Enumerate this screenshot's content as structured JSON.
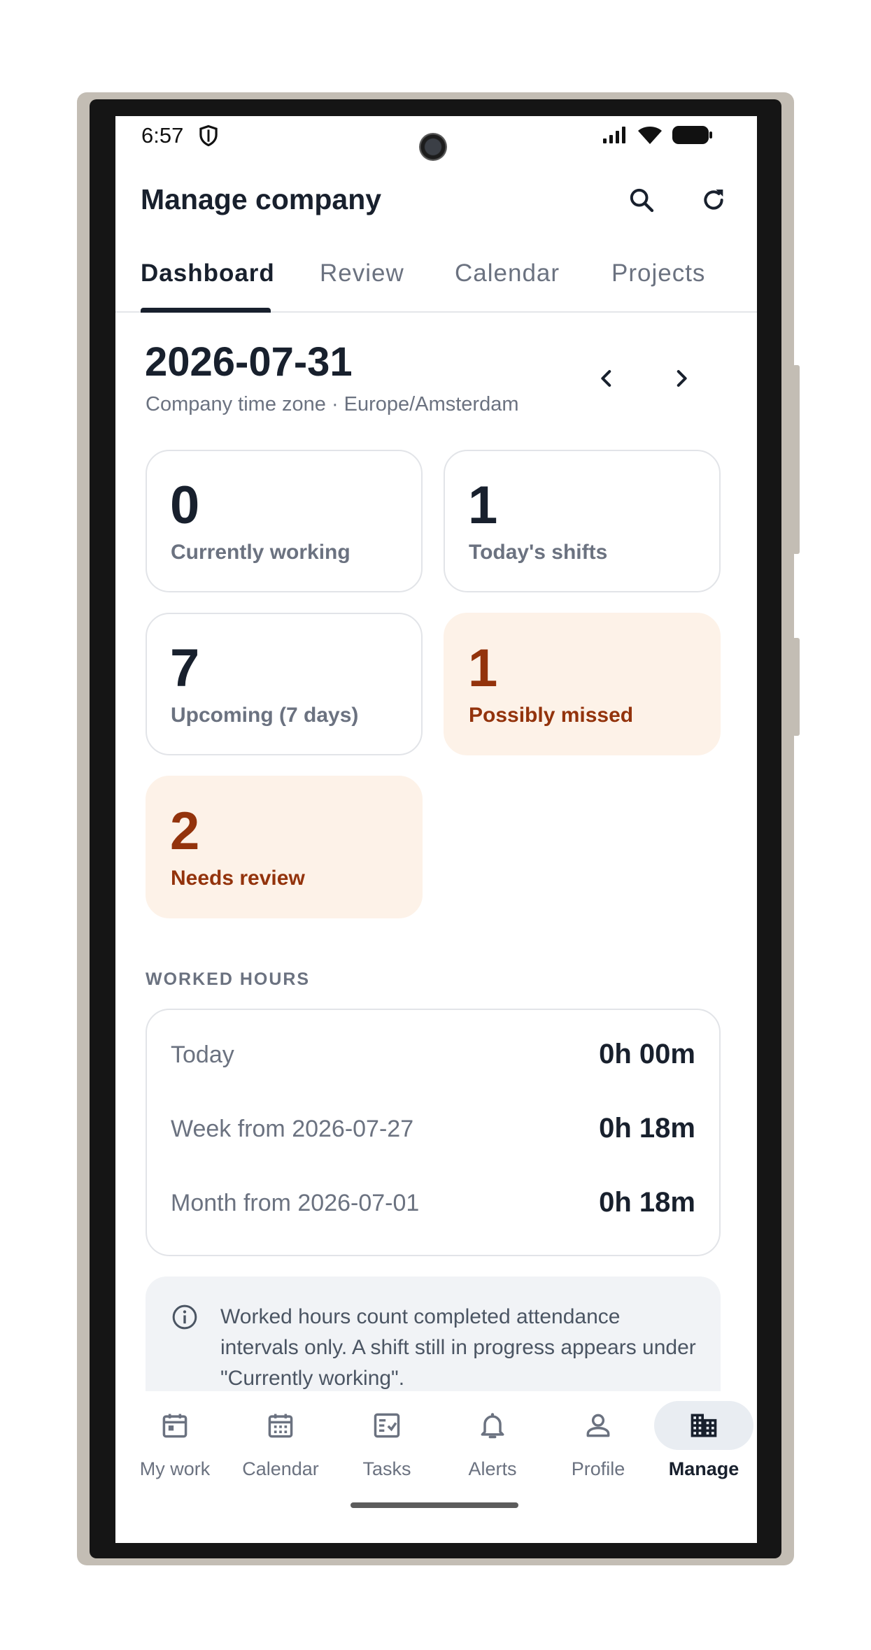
{
  "status_bar": {
    "time": "6:57"
  },
  "app_bar": {
    "title": "Manage company"
  },
  "tabs": [
    {
      "label": "Dashboard",
      "active": true
    },
    {
      "label": "Review",
      "active": false
    },
    {
      "label": "Calendar",
      "active": false
    },
    {
      "label": "Projects",
      "active": false
    }
  ],
  "date_header": {
    "date": "2026-07-31",
    "subtitle": "Company time zone · Europe/Amsterdam"
  },
  "stats": [
    {
      "value": "0",
      "label": "Currently working",
      "highlight": false
    },
    {
      "value": "1",
      "label": "Today's shifts",
      "highlight": false
    },
    {
      "value": "7",
      "label": "Upcoming (7 days)",
      "highlight": false
    },
    {
      "value": "1",
      "label": "Possibly missed",
      "highlight": true
    },
    {
      "value": "2",
      "label": "Needs review",
      "highlight": true
    }
  ],
  "worked_hours": {
    "section_label": "WORKED HOURS",
    "rows": [
      {
        "label": "Today",
        "value": "0h 00m"
      },
      {
        "label": "Week from 2026-07-27",
        "value": "0h 18m"
      },
      {
        "label": "Month from 2026-07-01",
        "value": "0h 18m"
      }
    ]
  },
  "info_note": "Worked hours count completed attendance intervals only. A shift still in progress appears under \"Currently working\".",
  "bottom_nav": [
    {
      "label": "My work",
      "icon": "calendar-day-icon",
      "active": false
    },
    {
      "label": "Calendar",
      "icon": "calendar-grid-icon",
      "active": false
    },
    {
      "label": "Tasks",
      "icon": "task-check-icon",
      "active": false
    },
    {
      "label": "Alerts",
      "icon": "bell-icon",
      "active": false
    },
    {
      "label": "Profile",
      "icon": "person-icon",
      "active": false
    },
    {
      "label": "Manage",
      "icon": "building-icon",
      "active": true
    }
  ],
  "colors": {
    "text_primary": "#18202d",
    "text_secondary": "#6b7280",
    "warn_bg": "#fdf2e8",
    "warn_text": "#93330c",
    "nav_active_pill": "#e9edf2"
  }
}
